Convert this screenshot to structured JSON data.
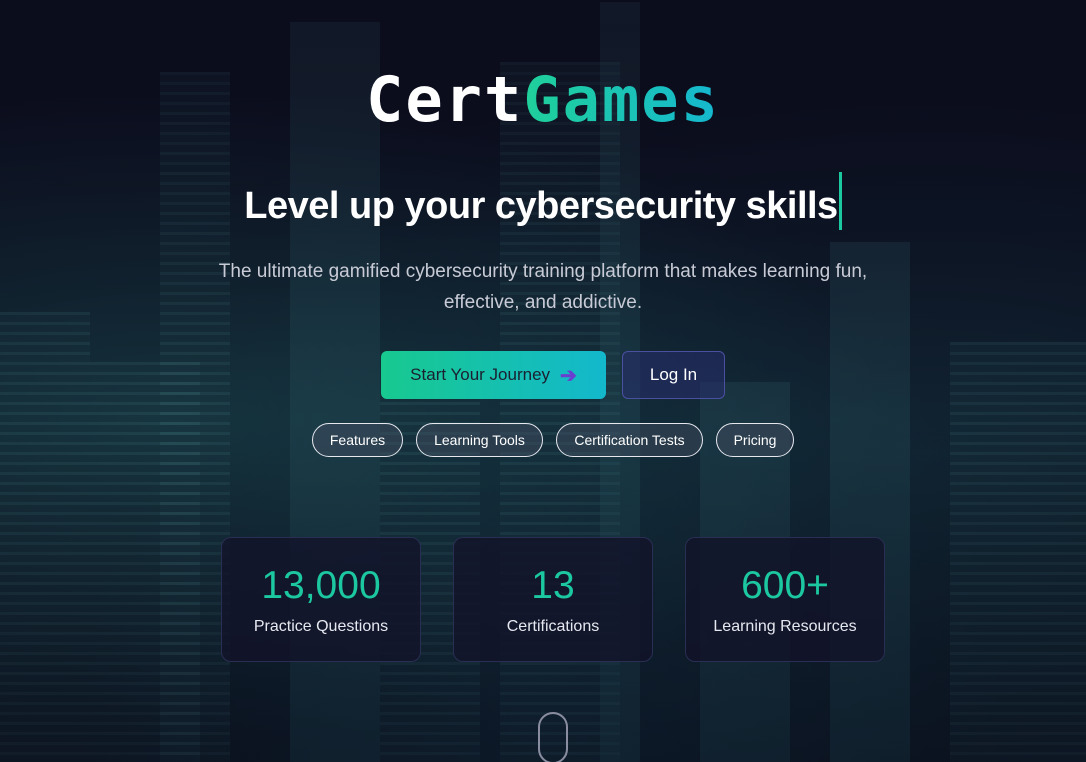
{
  "logo": {
    "part1": "Cert",
    "part2": "Games"
  },
  "hero": {
    "headline": "Level up your cybersecurity skills",
    "subtitle": "The ultimate gamified cybersecurity training platform that makes learning fun, effective, and addictive."
  },
  "buttons": {
    "primary": "Start Your Journey",
    "primary_icon": "arrow-right-icon",
    "login": "Log In"
  },
  "nav_pills": [
    "Features",
    "Learning Tools",
    "Certification Tests",
    "Pricing"
  ],
  "stats": [
    {
      "value": "13,000",
      "label": "Practice Questions"
    },
    {
      "value": "13",
      "label": "Certifications"
    },
    {
      "value": "600+",
      "label": "Learning Resources"
    }
  ],
  "colors": {
    "accent_green": "#1cc8a0",
    "accent_cyan": "#13b8cc",
    "background": "#0a0b1a",
    "login_bg": "#282d6e"
  }
}
